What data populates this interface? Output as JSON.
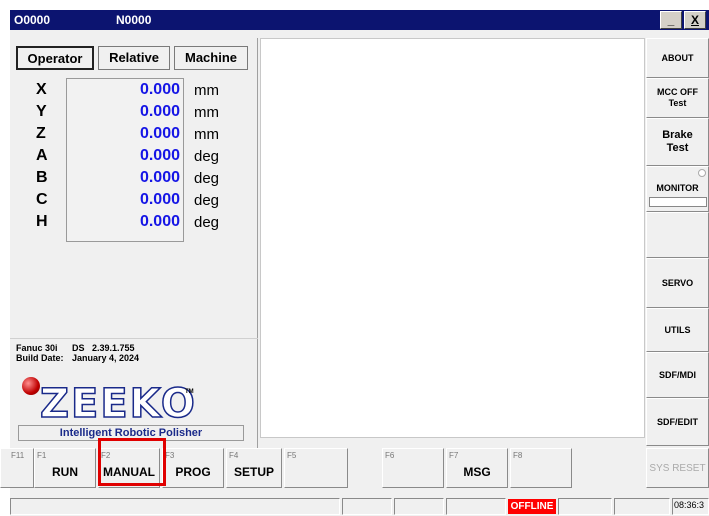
{
  "titlebar": {
    "program": "O0000",
    "sequence": "N0000",
    "minimize": "_",
    "close": "X"
  },
  "tabs": [
    {
      "label": "Operator",
      "active": true
    },
    {
      "label": "Relative",
      "active": false
    },
    {
      "label": "Machine",
      "active": false
    }
  ],
  "axes": [
    {
      "name": "X",
      "value": "0.000",
      "unit": "mm"
    },
    {
      "name": "Y",
      "value": "0.000",
      "unit": "mm"
    },
    {
      "name": "Z",
      "value": "0.000",
      "unit": "mm"
    },
    {
      "name": "A",
      "value": "0.000",
      "unit": "deg"
    },
    {
      "name": "B",
      "value": "0.000",
      "unit": "deg"
    },
    {
      "name": "C",
      "value": "0.000",
      "unit": "deg"
    },
    {
      "name": "H",
      "value": "0.000",
      "unit": "deg"
    }
  ],
  "info": {
    "controller": "Fanuc 30i",
    "ds_label": "DS",
    "version": "2.39.1.755",
    "build_label": "Build Date:",
    "build_date": "January 4, 2024",
    "logo": "ZEEKO",
    "logo_tm": "TM",
    "tagline": "Intelligent Robotic Polisher"
  },
  "right_buttons": {
    "about": "ABOUT",
    "mcc_line1": "MCC OFF",
    "mcc_line2": "Test",
    "brake_line1": "Brake",
    "brake_line2": "Test",
    "monitor": "MONITOR",
    "servo": "SERVO",
    "utils": "UTILS",
    "sdf_mdi": "SDF/MDI",
    "sdf_edit": "SDF/EDIT"
  },
  "fkeys": [
    {
      "num": "F11",
      "label": ""
    },
    {
      "num": "F1",
      "label": "RUN"
    },
    {
      "num": "F2",
      "label": "MANUAL"
    },
    {
      "num": "F3",
      "label": "PROG"
    },
    {
      "num": "F4",
      "label": "SETUP"
    },
    {
      "num": "F5",
      "label": ""
    },
    {
      "num": "F6",
      "label": ""
    },
    {
      "num": "F7",
      "label": "MSG"
    },
    {
      "num": "F8",
      "label": ""
    },
    {
      "num": "",
      "label": "SYS RESET"
    }
  ],
  "status": {
    "connection": "OFFLINE",
    "time": "08:36:3"
  },
  "colors": {
    "title_bg": "#0c1470",
    "value_blue": "#1515e6",
    "offline_red": "#ff0000",
    "highlight_red": "#e00000"
  }
}
